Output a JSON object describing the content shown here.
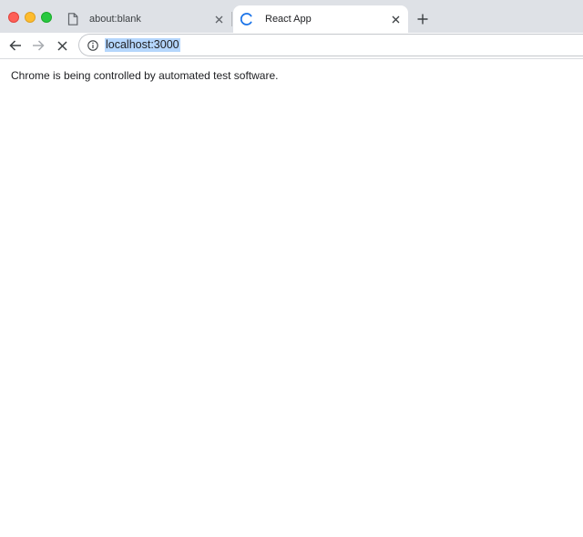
{
  "tabs": [
    {
      "title": "about:blank",
      "favicon": "page-icon",
      "active": false
    },
    {
      "title": "React App",
      "favicon": "loading-spinner-icon",
      "active": true
    }
  ],
  "toolbar": {
    "address": "localhost:3000",
    "address_selected": true,
    "page_loading": true
  },
  "infobar": {
    "message": "Chrome is being controlled by automated test software."
  },
  "colors": {
    "tabstrip_bg": "#dee1e6",
    "active_tab_bg": "#ffffff",
    "selection_highlight": "#b5d6fc",
    "spinner": "#1a73e8",
    "traffic_close": "#fe5f57",
    "traffic_minimize": "#febc2e",
    "traffic_maximize": "#28c840"
  }
}
